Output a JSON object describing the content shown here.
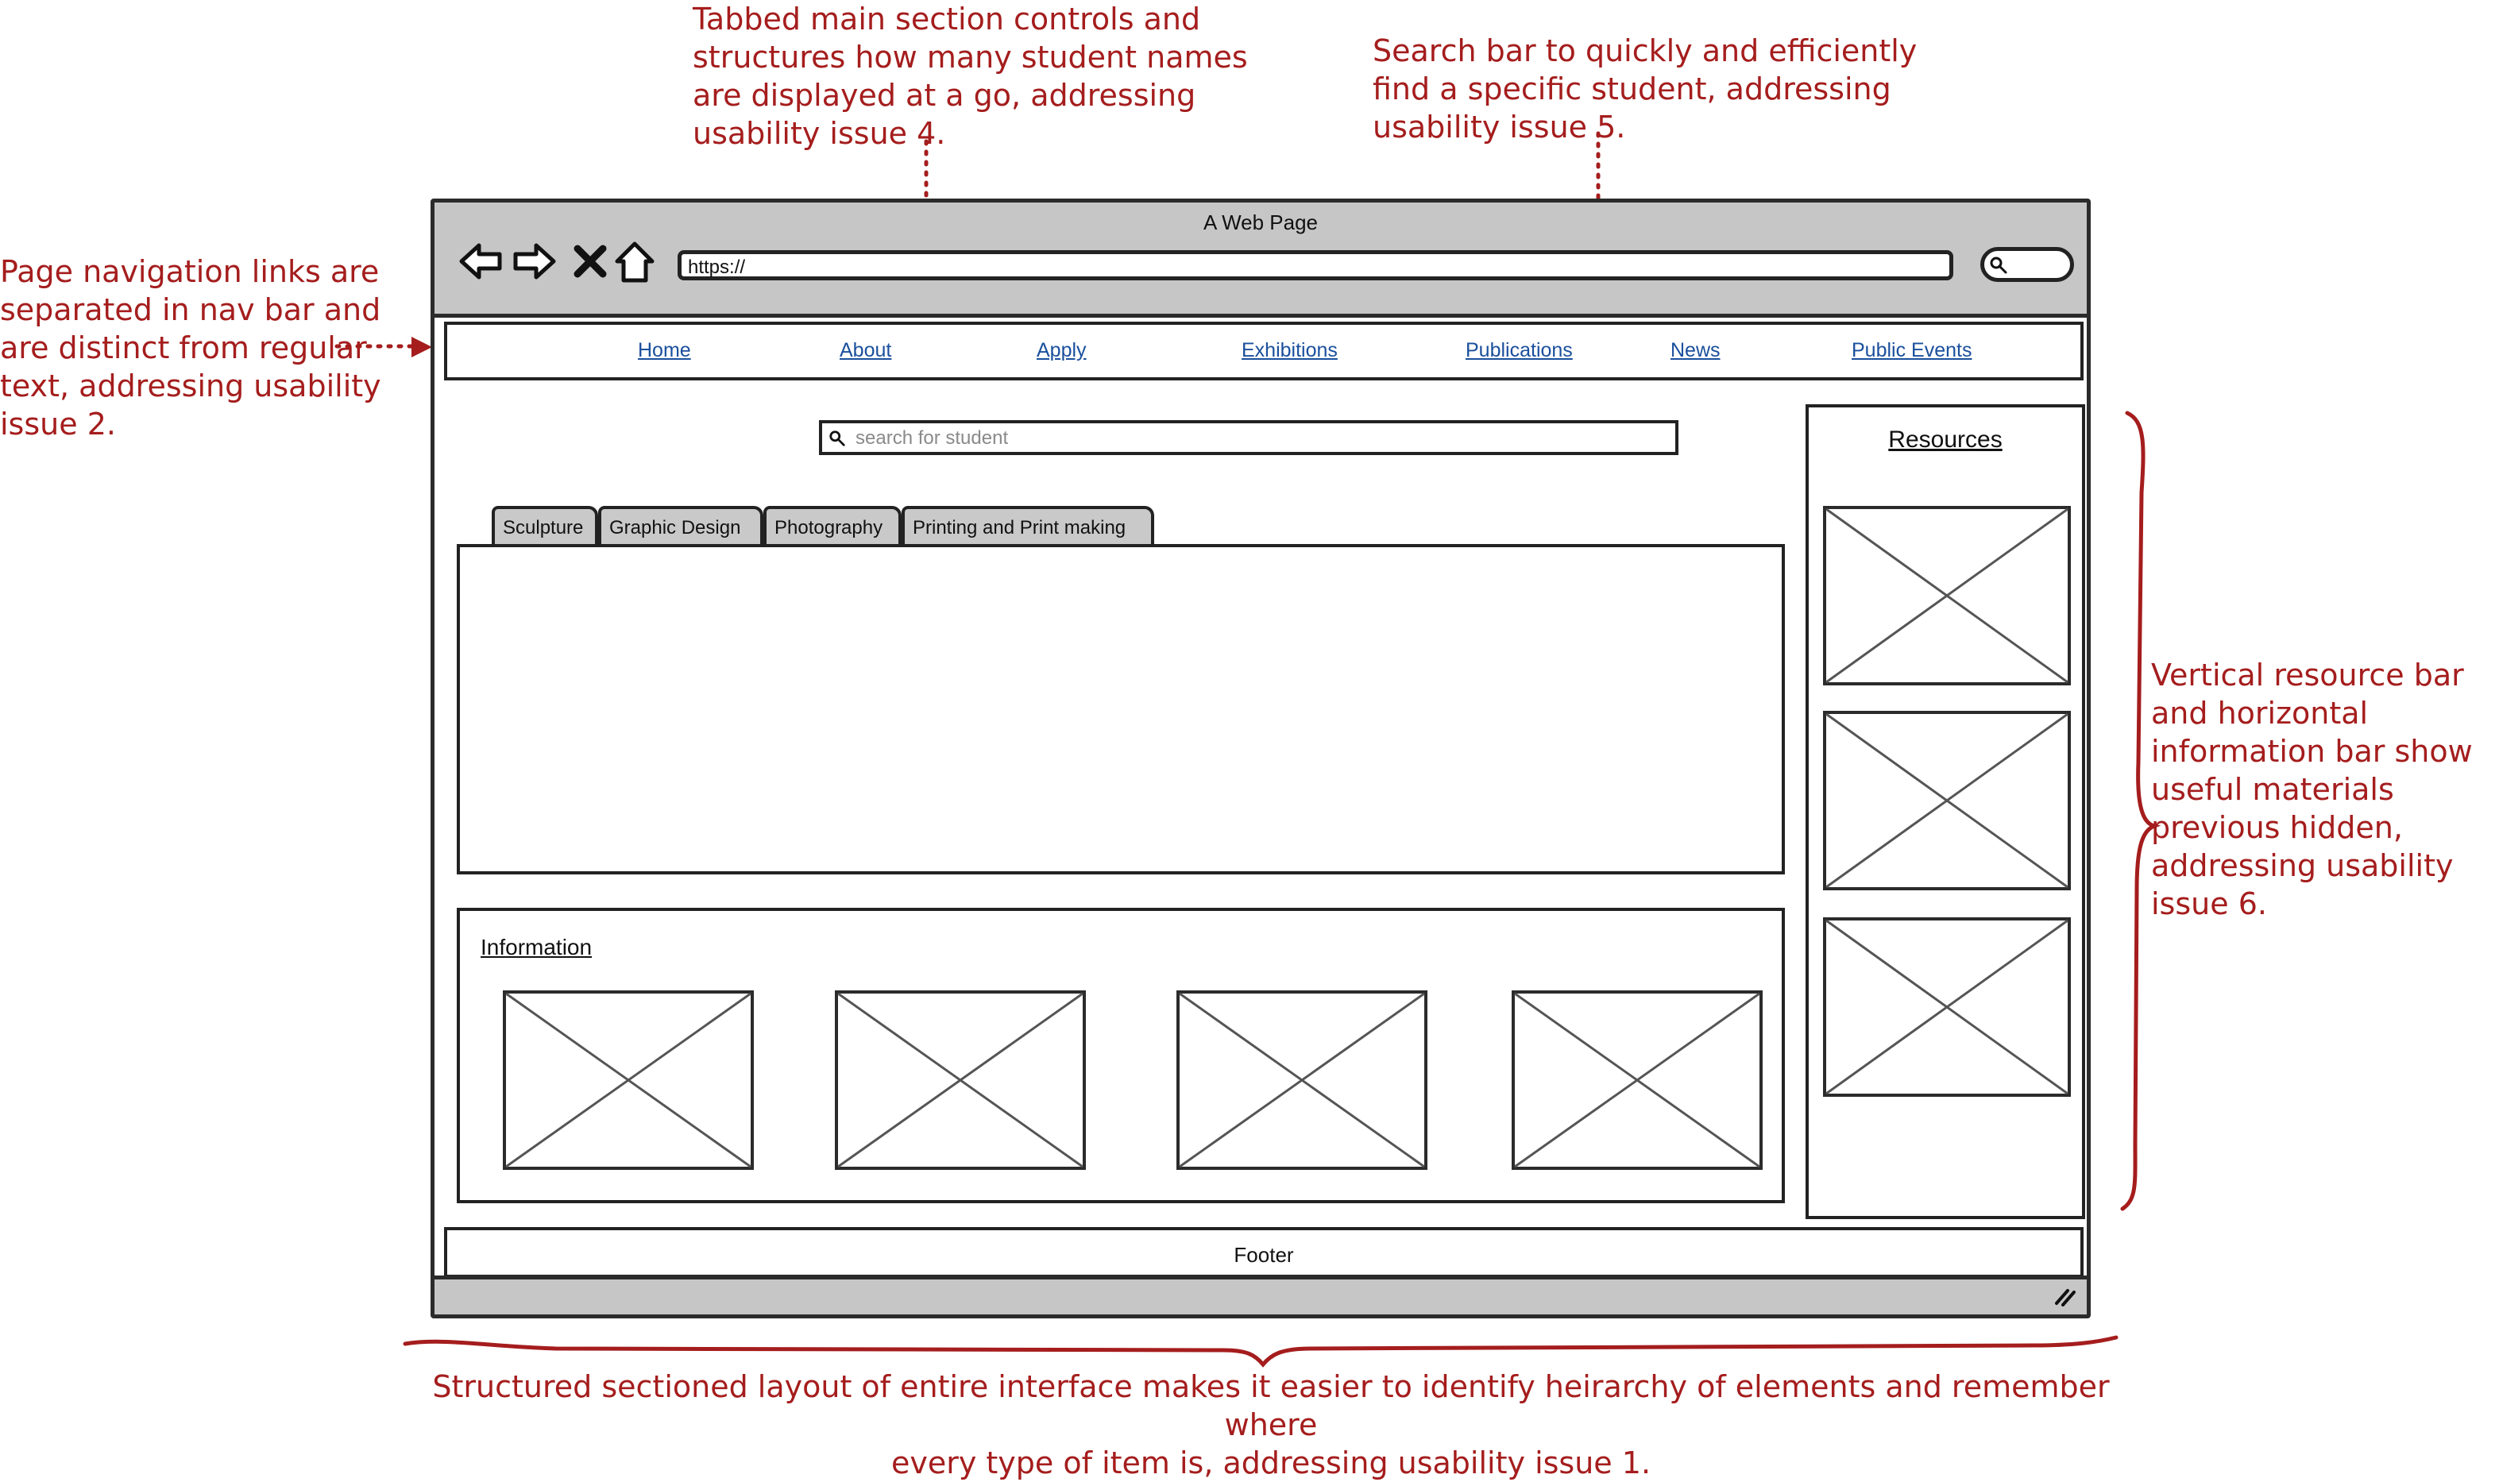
{
  "annotations": {
    "tabs_note": "Tabbed main section controls and\nstructures how many student names\nare displayed at a go, addressing\nusability issue 4.",
    "search_note": "Search bar to quickly and efficiently\nfind a specific student, addressing\nusability issue 5.",
    "nav_note": "Page navigation links are\nseparated in nav bar and\nare distinct from regular\ntext, addressing usability\nissue 2.",
    "resources_note": "Vertical resource bar\nand horizontal\ninformation bar show\nuseful materials\nprevious hidden,\naddressing usability\nissue 6.",
    "layout_note": "Structured sectioned layout of entire interface makes it easier to identify heirarchy of elements and remember where\nevery type of item is, addressing usability issue 1."
  },
  "browser": {
    "title": "A Web Page",
    "url": "https://",
    "icons": [
      "back-arrow-icon",
      "forward-arrow-icon",
      "close-x-icon",
      "home-icon",
      "search-icon"
    ]
  },
  "navbar": {
    "links": [
      "Home",
      "About",
      "Apply",
      "Exhibitions",
      "Publications",
      "News",
      "Public Events"
    ]
  },
  "search": {
    "placeholder": "search for student"
  },
  "tabs": [
    "Sculpture",
    "Graphic Design",
    "Photography",
    "Printing and Print making"
  ],
  "information": {
    "title": "Information"
  },
  "resources": {
    "title": "Resources"
  },
  "footer": {
    "label": "Footer"
  },
  "colors": {
    "annotation": "#a51d1d",
    "link": "#1a4f9c",
    "chrome": "#c6c6c6",
    "tab": "#c9c9c9"
  }
}
